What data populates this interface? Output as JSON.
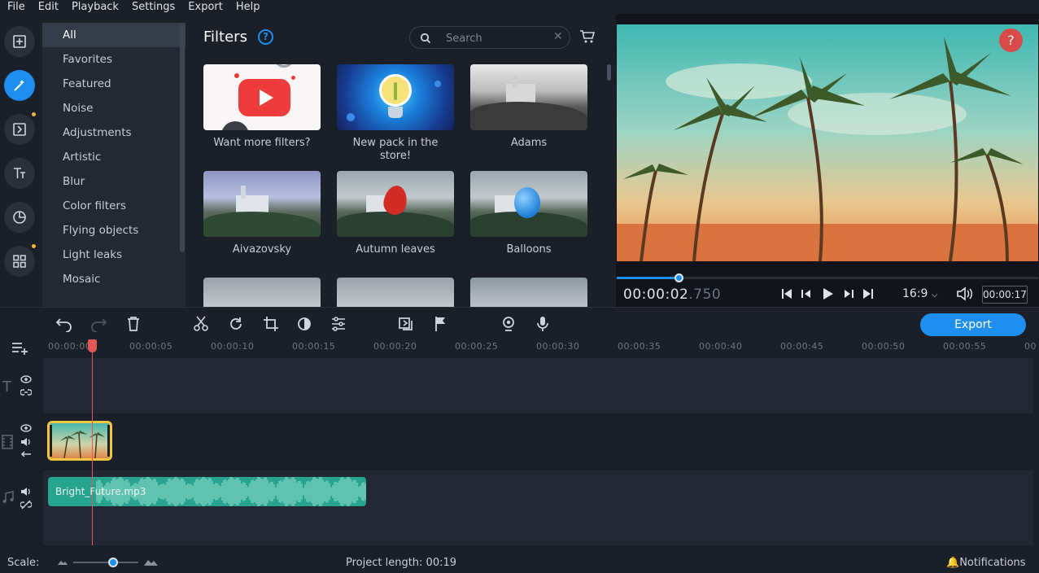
{
  "menu": [
    {
      "label": "File"
    },
    {
      "label": "Edit"
    },
    {
      "label": "Playback"
    },
    {
      "label": "Settings"
    },
    {
      "label": "Export"
    },
    {
      "label": "Help"
    }
  ],
  "categories": [
    "All",
    "Favorites",
    "Featured",
    "Noise",
    "Adjustments",
    "Artistic",
    "Blur",
    "Color filters",
    "Flying objects",
    "Light leaks",
    "Mosaic"
  ],
  "panel": {
    "title": "Filters",
    "search_placeholder": "Search",
    "tiles": [
      {
        "label": "Want more filters?"
      },
      {
        "label": "New pack in the store!"
      },
      {
        "label": "Adams"
      },
      {
        "label": "Aivazovsky"
      },
      {
        "label": "Autumn leaves"
      },
      {
        "label": "Balloons"
      }
    ]
  },
  "preview": {
    "timecode_main": "00:00:02",
    "timecode_ms": ".750",
    "aspect": "16:9",
    "duration": "00:00:17",
    "help": "?",
    "progress_fraction": 0.148
  },
  "toolbar": {
    "export_label": "Export"
  },
  "ruler": [
    "00:00:00",
    "00:00:05",
    "00:00:10",
    "00:00:15",
    "00:00:20",
    "00:00:25",
    "00:00:30",
    "00:00:35",
    "00:00:40",
    "00:00:45",
    "00:00:50",
    "00:00:55",
    "00"
  ],
  "timeline": {
    "audio_clip": "Bright_Future.mp3"
  },
  "status": {
    "scale_label": "Scale:",
    "project_length": "Project length:  00:19",
    "notifications": "Notifications"
  },
  "colors": {
    "accent": "#1e8ef0",
    "playhead": "#e55656",
    "audio_clip": "#27a48f",
    "video_clip_border": "#f2c640"
  }
}
